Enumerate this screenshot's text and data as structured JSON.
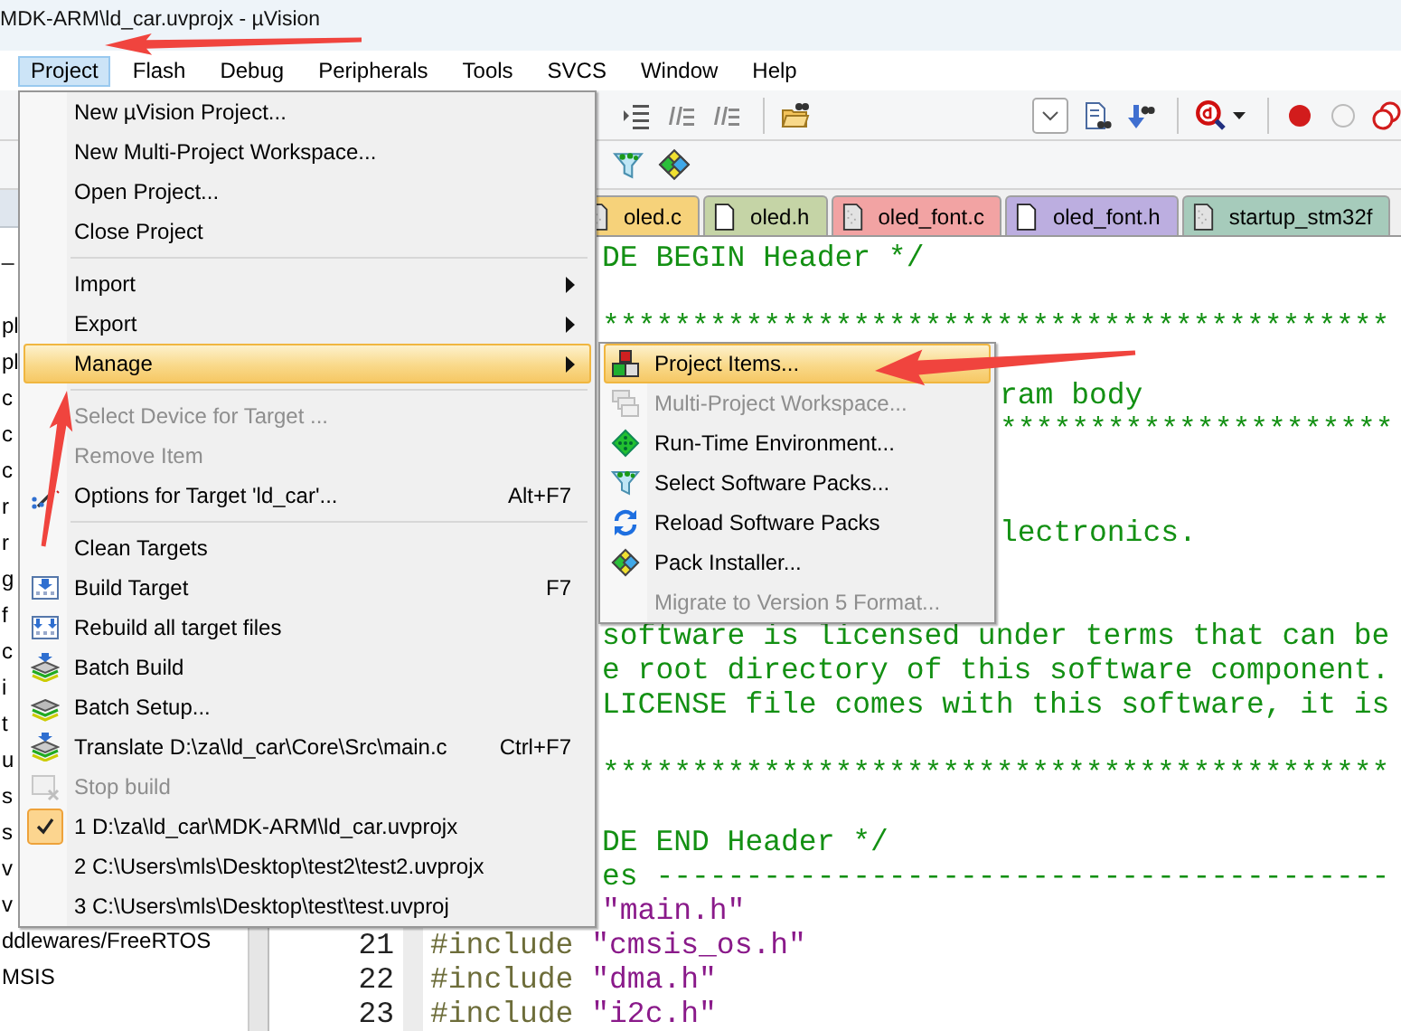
{
  "window": {
    "title": "MDK-ARM\\ld_car.uvprojx - µVision"
  },
  "menu_bar": [
    {
      "label": "Project",
      "selected": true
    },
    {
      "label": "Flash",
      "selected": false
    },
    {
      "label": "Debug",
      "selected": false
    },
    {
      "label": "Peripherals",
      "selected": false
    },
    {
      "label": "Tools",
      "selected": false
    },
    {
      "label": "SVCS",
      "selected": false
    },
    {
      "label": "Window",
      "selected": false
    },
    {
      "label": "Help",
      "selected": false
    }
  ],
  "project_tree": {
    "items": [
      {
        "text": "_"
      },
      {
        "text": "pl"
      },
      {
        "text": "pl"
      },
      {
        "text": "c"
      },
      {
        "text": "c"
      },
      {
        "text": "c"
      },
      {
        "text": "r"
      },
      {
        "text": "r"
      },
      {
        "text": "g"
      },
      {
        "text": "f"
      },
      {
        "text": "c"
      },
      {
        "text": "i"
      },
      {
        "text": "t"
      },
      {
        "text": "u"
      },
      {
        "text": "s"
      },
      {
        "text": "s"
      },
      {
        "text": "v"
      },
      {
        "text": "v"
      },
      {
        "text": "ddlewares/FreeRTOS"
      },
      {
        "text": "MSIS"
      }
    ]
  },
  "editor": {
    "tabs": [
      {
        "label": "oled.c",
        "kind": "source",
        "color": "#f6d27a"
      },
      {
        "label": "oled.h",
        "kind": "header",
        "color": "#c5d4a6"
      },
      {
        "label": "oled_font.c",
        "kind": "source",
        "color": "#f2a3a3"
      },
      {
        "label": "oled_font.h",
        "kind": "header",
        "color": "#bcaee0"
      },
      {
        "label": "startup_stm32f",
        "kind": "source",
        "color": "#a6cbbb"
      }
    ],
    "lines": [
      {
        "kind": "menu-clipped",
        "segments": [
          {
            "kind": "comment",
            "text": "DE BEGIN Header */"
          }
        ]
      },
      {
        "kind": "blank"
      },
      {
        "kind": "menu-clipped",
        "segments": [
          {
            "kind": "comment",
            "text": "********************************************"
          }
        ]
      },
      {
        "kind": "blank"
      },
      {
        "kind": "submenu-clipped",
        "segments": [
          {
            "kind": "comment",
            "text": "ram body"
          }
        ]
      },
      {
        "kind": "submenu-clipped",
        "segments": [
          {
            "kind": "comment",
            "text": "**********************"
          }
        ]
      },
      {
        "kind": "blank"
      },
      {
        "kind": "blank"
      },
      {
        "kind": "submenu-clipped",
        "segments": [
          {
            "kind": "comment",
            "text": "lectronics."
          }
        ]
      },
      {
        "kind": "blank"
      },
      {
        "kind": "blank"
      },
      {
        "kind": "menu-clipped",
        "segments": [
          {
            "kind": "comment",
            "text": "software is licensed under terms that can be"
          }
        ]
      },
      {
        "kind": "menu-clipped",
        "segments": [
          {
            "kind": "comment",
            "text": "e root directory of this software component."
          }
        ]
      },
      {
        "kind": "menu-clipped",
        "segments": [
          {
            "kind": "comment",
            "text": "LICENSE file comes with this software, it is"
          }
        ]
      },
      {
        "kind": "blank"
      },
      {
        "kind": "menu-clipped",
        "segments": [
          {
            "kind": "comment",
            "text": "********************************************"
          }
        ]
      },
      {
        "kind": "blank"
      },
      {
        "kind": "menu-clipped",
        "segments": [
          {
            "kind": "comment",
            "text": "DE END Header */"
          }
        ]
      },
      {
        "kind": "menu-clipped",
        "segments": [
          {
            "kind": "comment",
            "text": "es -----------------------------------------"
          }
        ]
      },
      {
        "kind": "menu-clipped",
        "segments": [
          {
            "kind": "string",
            "text": "\"main.h\""
          }
        ]
      },
      {
        "kind": "full",
        "number": "21",
        "segments": [
          {
            "kind": "preprocessor",
            "text": "#include"
          },
          {
            "kind": "string",
            "text": "\"cmsis_os.h\""
          }
        ]
      },
      {
        "kind": "full",
        "number": "22",
        "segments": [
          {
            "kind": "preprocessor",
            "text": "#include"
          },
          {
            "kind": "string",
            "text": "\"dma.h\""
          }
        ]
      },
      {
        "kind": "full",
        "number": "23",
        "segments": [
          {
            "kind": "preprocessor",
            "text": "#include"
          },
          {
            "kind": "string",
            "text": "\"i2c.h\""
          }
        ]
      }
    ]
  },
  "project_menu": {
    "items": [
      {
        "kind": "item",
        "label": "New µVision Project...",
        "submenu": false,
        "disabled": false,
        "selected": false,
        "checked": false
      },
      {
        "kind": "item",
        "label": "New Multi-Project Workspace...",
        "submenu": false,
        "disabled": false,
        "selected": false,
        "checked": false
      },
      {
        "kind": "item",
        "label": "Open Project...",
        "submenu": false,
        "disabled": false,
        "selected": false,
        "checked": false
      },
      {
        "kind": "item",
        "label": "Close Project",
        "submenu": false,
        "disabled": false,
        "selected": false,
        "checked": false
      },
      {
        "kind": "separator"
      },
      {
        "kind": "item",
        "label": "Import",
        "submenu": true,
        "disabled": false,
        "selected": false,
        "checked": false
      },
      {
        "kind": "item",
        "label": "Export",
        "submenu": true,
        "disabled": false,
        "selected": false,
        "checked": false
      },
      {
        "kind": "item",
        "label": "Manage",
        "submenu": true,
        "disabled": false,
        "selected": true,
        "checked": false
      },
      {
        "kind": "separator"
      },
      {
        "kind": "item",
        "label": "Select Device for Target ...",
        "submenu": false,
        "disabled": true,
        "selected": false,
        "checked": false
      },
      {
        "kind": "item",
        "label": "Remove Item",
        "submenu": false,
        "disabled": true,
        "selected": false,
        "checked": false
      },
      {
        "kind": "item",
        "label": "Options for Target 'ld_car'...",
        "shortcut": "Alt+F7",
        "submenu": false,
        "disabled": false,
        "selected": false,
        "checked": false
      },
      {
        "kind": "separator"
      },
      {
        "kind": "item",
        "label": "Clean Targets",
        "submenu": false,
        "disabled": false,
        "selected": false,
        "checked": false
      },
      {
        "kind": "item",
        "label": "Build Target",
        "shortcut": "F7",
        "submenu": false,
        "disabled": false,
        "selected": false,
        "checked": false
      },
      {
        "kind": "item",
        "label": "Rebuild all target files",
        "submenu": false,
        "disabled": false,
        "selected": false,
        "checked": false
      },
      {
        "kind": "item",
        "label": "Batch Build",
        "submenu": false,
        "disabled": false,
        "selected": false,
        "checked": false
      },
      {
        "kind": "item",
        "label": "Batch Setup...",
        "submenu": false,
        "disabled": false,
        "selected": false,
        "checked": false
      },
      {
        "kind": "item",
        "label": "Translate D:\\za\\ld_car\\Core\\Src\\main.c",
        "shortcut": "Ctrl+F7",
        "submenu": false,
        "disabled": false,
        "selected": false,
        "checked": false
      },
      {
        "kind": "item",
        "label": "Stop build",
        "submenu": false,
        "disabled": true,
        "selected": false,
        "checked": false
      },
      {
        "kind": "item",
        "label": "1 D:\\za\\ld_car\\MDK-ARM\\ld_car.uvprojx",
        "submenu": false,
        "disabled": false,
        "selected": false,
        "checked": true
      },
      {
        "kind": "item",
        "label": "2 C:\\Users\\mls\\Desktop\\test2\\test2.uvprojx",
        "submenu": false,
        "disabled": false,
        "selected": false,
        "checked": false
      },
      {
        "kind": "item",
        "label": "3 C:\\Users\\mls\\Desktop\\test\\test.uvproj",
        "submenu": false,
        "disabled": false,
        "selected": false,
        "checked": false
      }
    ]
  },
  "manage_submenu": {
    "items": [
      {
        "kind": "item",
        "label": "Project Items...",
        "submenu": false,
        "disabled": false,
        "selected": true,
        "checked": false
      },
      {
        "kind": "item",
        "label": "Multi-Project Workspace...",
        "submenu": false,
        "disabled": true,
        "selected": false,
        "checked": false
      },
      {
        "kind": "item",
        "label": "Run-Time Environment...",
        "submenu": false,
        "disabled": false,
        "selected": false,
        "checked": false
      },
      {
        "kind": "item",
        "label": "Select Software Packs...",
        "submenu": false,
        "disabled": false,
        "selected": false,
        "checked": false
      },
      {
        "kind": "item",
        "label": "Reload Software Packs",
        "submenu": false,
        "disabled": false,
        "selected": false,
        "checked": false
      },
      {
        "kind": "item",
        "label": "Pack Installer...",
        "submenu": false,
        "disabled": false,
        "selected": false,
        "checked": false
      },
      {
        "kind": "item",
        "label": "Migrate to Version 5 Format...",
        "submenu": false,
        "disabled": true,
        "selected": false,
        "checked": false
      }
    ]
  }
}
